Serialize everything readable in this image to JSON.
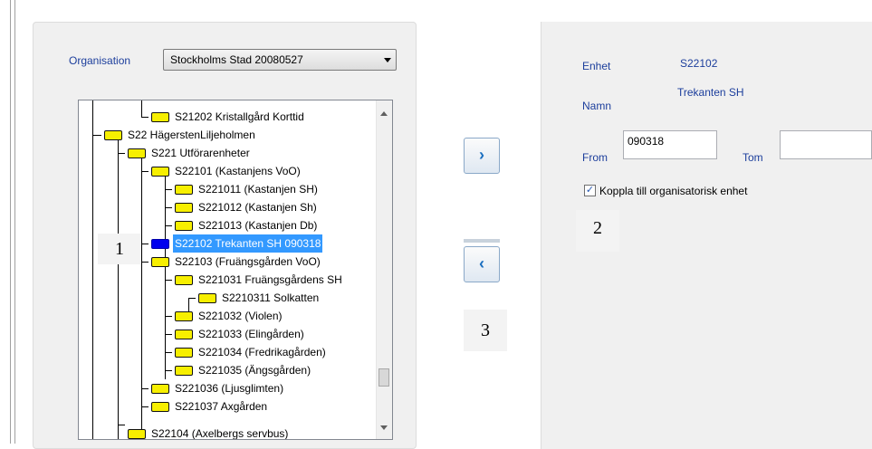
{
  "organisation": {
    "label": "Organisation",
    "selected": "Stockholms Stad 20080527"
  },
  "tree": [
    {
      "text": "S21202  Kristallgård Korttid"
    },
    {
      "text": "S22  HägerstenLiljeholmen"
    },
    {
      "text": "S221  Utförarenheter"
    },
    {
      "text": "S22101  (Kastanjens VoO)"
    },
    {
      "text": "S221011  (Kastanjen SH)"
    },
    {
      "text": "S221012  (Kastanjen Sh)"
    },
    {
      "text": "S221013  (Kastanjen Db)"
    },
    {
      "text": "S22102  Trekanten SH  090318",
      "selected": true
    },
    {
      "text": "S22103  (Fruängsgården VoO)"
    },
    {
      "text": "S221031  Fruängsgårdens SH"
    },
    {
      "text": "S2210311  Solkatten"
    },
    {
      "text": "S221032  (Violen)"
    },
    {
      "text": "S221033  (Elingården)"
    },
    {
      "text": "S221034  (Fredrikagården)"
    },
    {
      "text": "S221035  (Ängsgården)"
    },
    {
      "text": "S221036  (Ljusglimten)"
    },
    {
      "text": "S221037  Axgården"
    },
    {
      "text": "S22104  (Axelbergs servbus)"
    }
  ],
  "buttons": {
    "move_right": "›",
    "move_left": "‹"
  },
  "details": {
    "enhet_label": "Enhet",
    "enhet_value": "S22102",
    "namn_label": "Namn",
    "namn_value": "Trekanten SH",
    "from_label": "From",
    "from_value": "090318",
    "tom_label": "Tom",
    "tom_value": "",
    "koppla_label": "Koppla till organisatorisk enhet",
    "koppla_checked": true
  },
  "annotations": [
    "1",
    "2",
    "3"
  ]
}
